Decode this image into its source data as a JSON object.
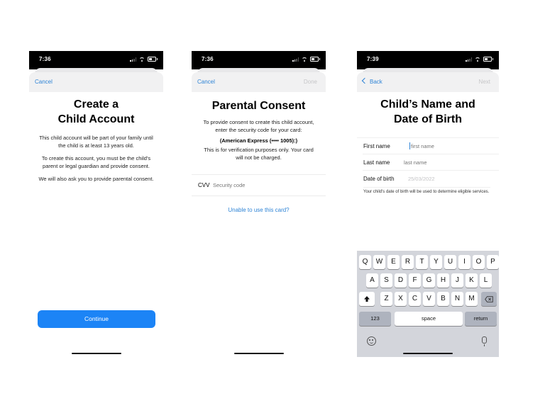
{
  "screens": [
    {
      "status": {
        "time": "7:36"
      },
      "nav": {
        "left": "Cancel"
      },
      "title": "Create a Child Account",
      "title_line1": "Create a",
      "title_line2": "Child Account",
      "paragraphs": [
        "This child account will be part of your family until the child is at least 13 years old.",
        "To create this account, you must be the child's parent or legal guardian and provide consent.",
        "We will also ask you to provide parental consent."
      ],
      "button": "Continue"
    },
    {
      "status": {
        "time": "7:36"
      },
      "nav": {
        "left": "Cancel",
        "right": "Done"
      },
      "title": "Parental Consent",
      "intro": "To provide consent to create this child account, enter the security code for your card:",
      "card": "(American Express (•••• 1005):)",
      "disclaimer": "This is for verification purposes only. Your card will not be charged.",
      "cvv": {
        "label": "CVV",
        "placeholder": "Security code",
        "value": ""
      },
      "link": "Unable to use this card?"
    },
    {
      "status": {
        "time": "7:39"
      },
      "nav": {
        "left": "Back",
        "right": "Next"
      },
      "title_line1": "Child’s Name and",
      "title_line2": "Date of Birth",
      "fields": [
        {
          "label": "First name",
          "placeholder": "first name",
          "value": ""
        },
        {
          "label": "Last name",
          "placeholder": "last name",
          "value": ""
        },
        {
          "label": "Date of birth",
          "placeholder": "",
          "value": "25/03/2022"
        }
      ],
      "note": "Your child's date of birth will be used to determine eligible services.",
      "keyboard": {
        "row1": [
          "Q",
          "W",
          "E",
          "R",
          "T",
          "Y",
          "U",
          "I",
          "O",
          "P"
        ],
        "row2": [
          "A",
          "S",
          "D",
          "F",
          "G",
          "H",
          "J",
          "K",
          "L"
        ],
        "row3": [
          "Z",
          "X",
          "C",
          "V",
          "B",
          "N",
          "M"
        ],
        "numbers": "123",
        "space": "space",
        "return": "return"
      }
    }
  ],
  "colors": {
    "accent": "#1c84f6",
    "link": "#2f84d6",
    "disabled": "#c6c6c8"
  }
}
